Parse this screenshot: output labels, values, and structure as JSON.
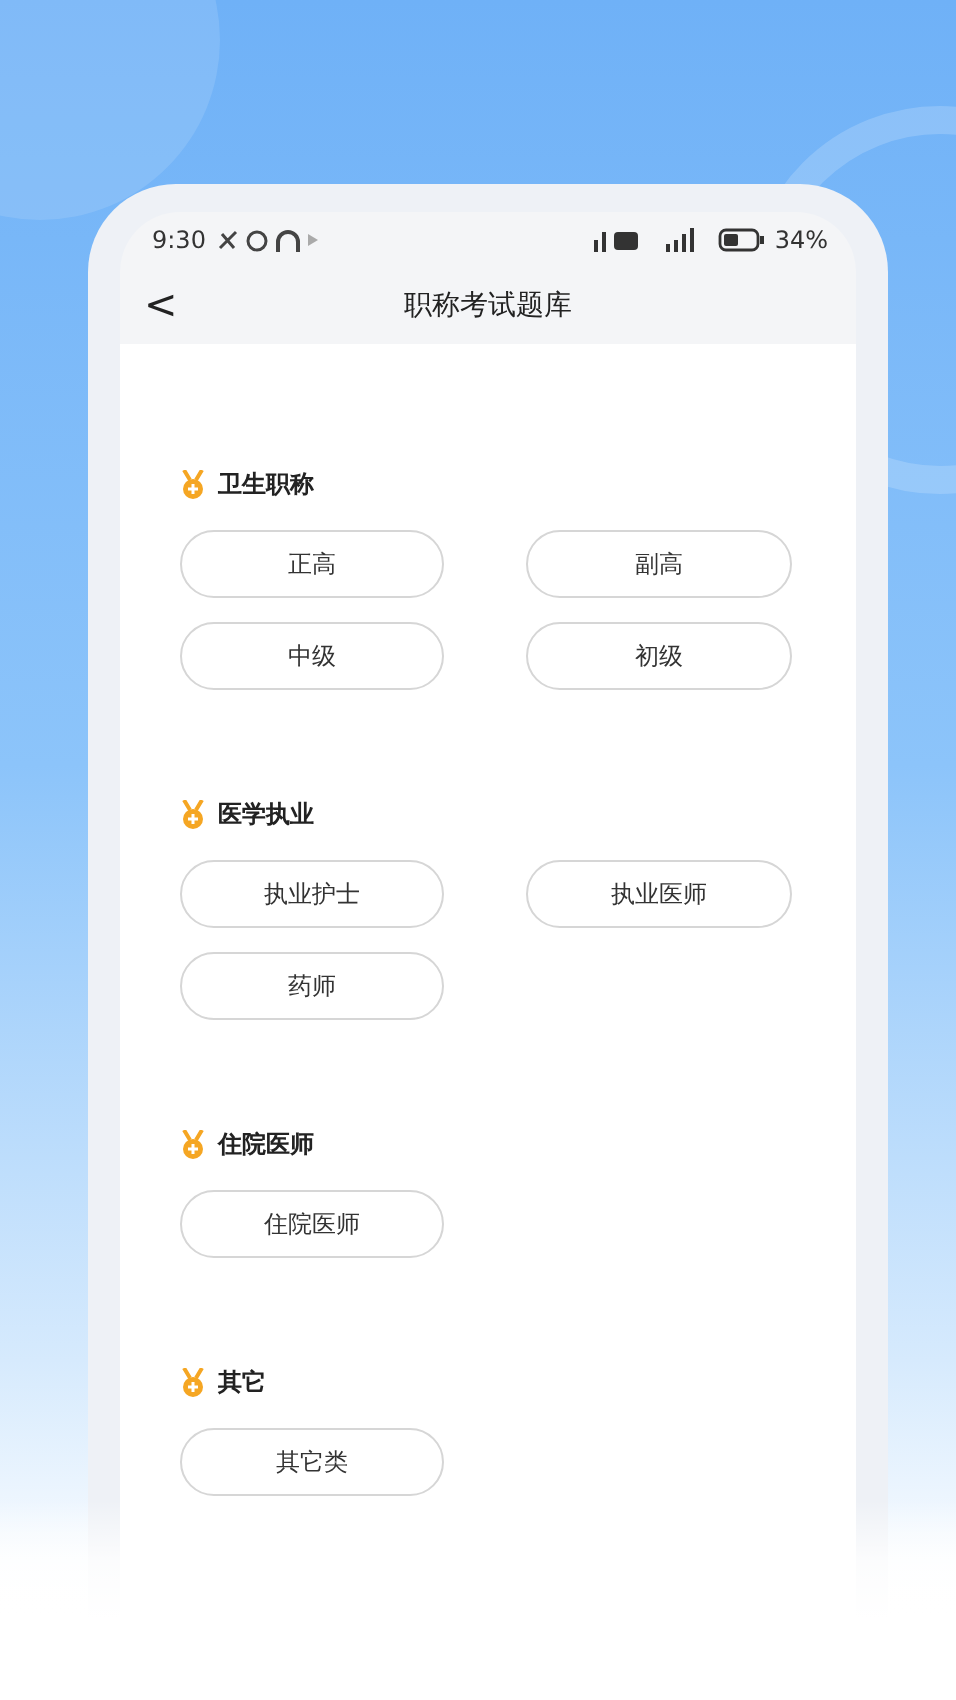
{
  "status_bar": {
    "time": "9:30",
    "battery": "34%"
  },
  "nav": {
    "back": "<",
    "title": "职称考试题库"
  },
  "sections": [
    {
      "title": "卫生职称",
      "options": [
        "正高",
        "副高",
        "中级",
        "初级"
      ]
    },
    {
      "title": "医学执业",
      "options": [
        "执业护士",
        "执业医师",
        "药师"
      ]
    },
    {
      "title": "住院医师",
      "options": [
        "住院医师"
      ]
    },
    {
      "title": "其它",
      "options": [
        "其它类"
      ]
    }
  ]
}
